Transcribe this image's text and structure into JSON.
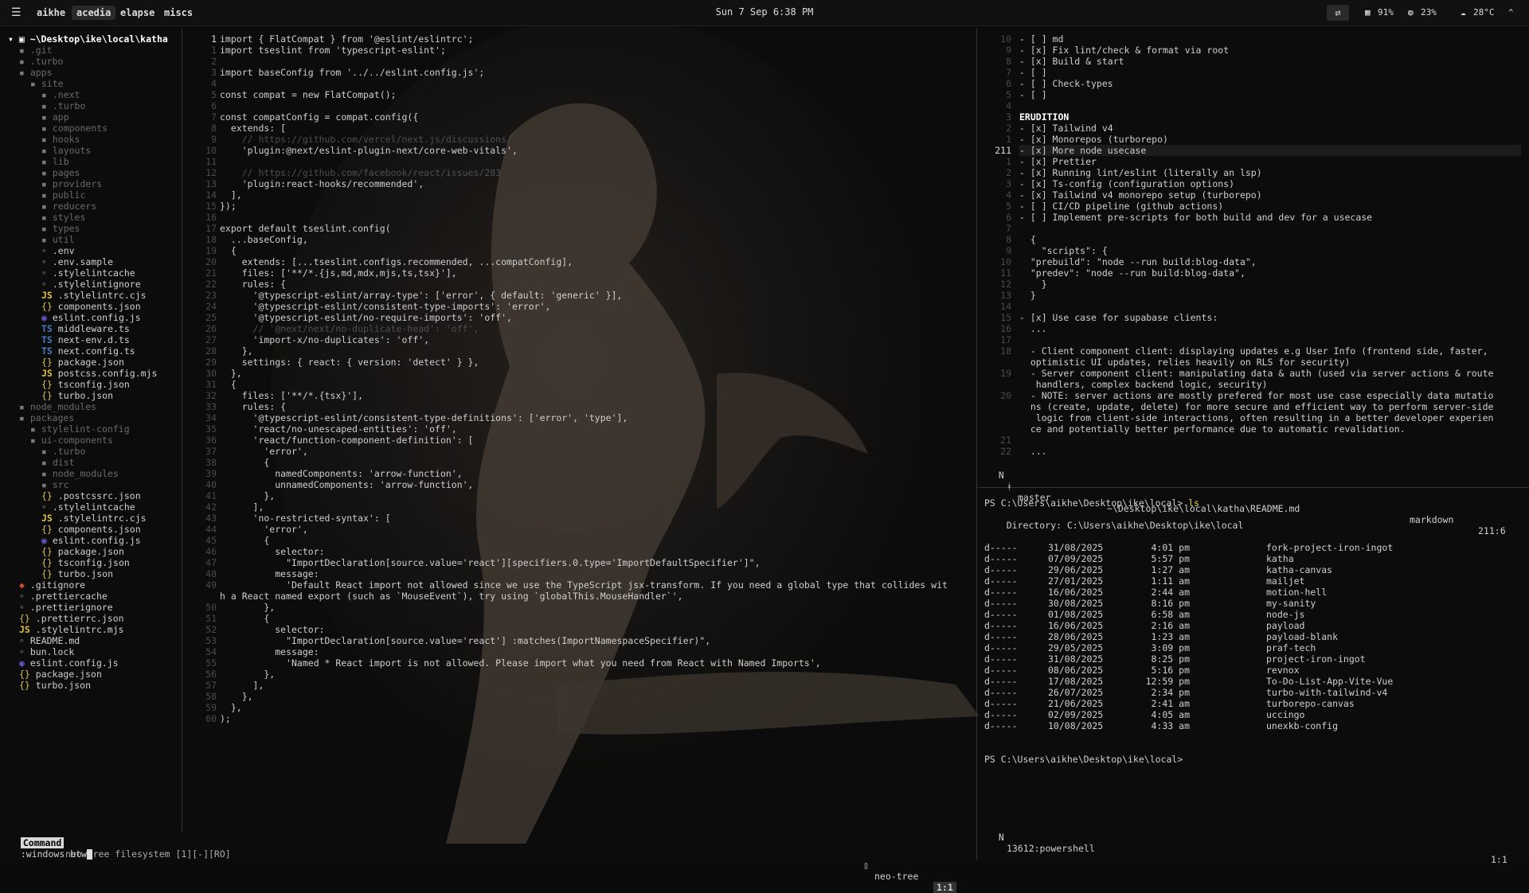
{
  "topbar": {
    "workspaces": [
      "aikhe",
      "acedia",
      "elapse",
      "miscs"
    ],
    "active_workspace": "acedia",
    "clock": "Sun 7 Sep 6:38 PM",
    "cpu": "91%",
    "mem": "23%",
    "temp": "28°C"
  },
  "tree": {
    "root": "~\\Desktop\\ike\\local\\katha",
    "items": [
      ".git",
      ".turbo",
      "apps",
      "site",
      ".next",
      ".turbo",
      "app",
      "components",
      "hooks",
      "layouts",
      "lib",
      "pages",
      "providers",
      "public",
      "reducers",
      "styles",
      "types",
      "util",
      ".env",
      ".env.sample",
      ".stylelintcache",
      ".stylelintignore",
      ".stylelintrc.cjs",
      "components.json",
      "eslint.config.js",
      "middleware.ts",
      "next-env.d.ts",
      "next.config.ts",
      "package.json",
      "postcss.config.mjs",
      "tsconfig.json",
      "turbo.json",
      "node_modules",
      "packages",
      "stylelint-config",
      "ui-components",
      ".turbo",
      "dist",
      "node_modules",
      "src",
      ".postcssrc.json",
      ".stylelintcache",
      ".stylelintrc.cjs",
      "components.json",
      "eslint.config.js",
      "package.json",
      "tsconfig.json",
      "turbo.json",
      ".gitignore",
      ".prettiercache",
      ".prettierignore",
      ".prettierrc.json",
      ".stylelintrc.mjs",
      "README.md",
      "bun.lock",
      "eslint.config.js",
      "package.json",
      "turbo.json"
    ]
  },
  "code": {
    "lines": [
      "import { FlatCompat } from '@eslint/eslintrc';",
      "import tseslint from 'typescript-eslint';",
      "",
      "import baseConfig from '../../eslint.config.js';",
      "",
      "const compat = new FlatCompat();",
      "",
      "const compatConfig = compat.config({",
      "  extends: [",
      "    // https://github.com/vercel/next.js/discussions/",
      "    'plugin:@next/eslint-plugin-next/core-web-vitals',",
      "",
      "    // https://github.com/facebook/react/issues/283",
      "    'plugin:react-hooks/recommended',",
      "  ],",
      "});",
      "",
      "export default tseslint.config(",
      "  ...baseConfig,",
      "  {",
      "    extends: [...tseslint.configs.recommended, ...compatConfig],",
      "    files: ['**/*.{js,md,mdx,mjs,ts,tsx}'],",
      "    rules: {",
      "      '@typescript-eslint/array-type': ['error', { default: 'generic' }],",
      "      '@typescript-eslint/consistent-type-imports': 'error',",
      "      '@typescript-eslint/no-require-imports': 'off',",
      "      // '@next/next/no-duplicate-head': 'off',",
      "      'import-x/no-duplicates': 'off',",
      "    },",
      "    settings: { react: { version: 'detect' } },",
      "  },",
      "  {",
      "    files: ['**/*.{tsx}'],",
      "    rules: {",
      "      '@typescript-eslint/consistent-type-definitions': ['error', 'type'],",
      "      'react/no-unescaped-entities': 'off',",
      "      'react/function-component-definition': [",
      "        'error',",
      "        {",
      "          namedComponents: 'arrow-function',",
      "          unnamedComponents: 'arrow-function',",
      "        },",
      "      ],",
      "      'no-restricted-syntax': [",
      "        'error',",
      "        {",
      "          selector:",
      "            \"ImportDeclaration[source.value='react'][specifiers.0.type='ImportDefaultSpecifier']\",",
      "          message:",
      "            'Default React import not allowed since we use the TypeScript jsx-transform. If you need a global type that collides wit",
      "h a React named export (such as `MouseEvent`), try using `globalThis.MouseHandler`',",
      "        },",
      "        {",
      "          selector:",
      "            \"ImportDeclaration[source.value='react'] :matches(ImportNamespaceSpecifier)\",",
      "          message:",
      "            'Named * React import is not allowed. Please import what you need from React with Named Imports',",
      "        },",
      "      ],",
      "    },",
      "  },",
      ");"
    ],
    "gutter": [
      "1",
      "1",
      "2",
      "3",
      "4",
      "5",
      "6",
      "7",
      "8",
      "9",
      "10",
      "11",
      "12",
      "13",
      "14",
      "15",
      "16",
      "17",
      "18",
      "19",
      "20",
      "21",
      "22",
      "23",
      "24",
      "25",
      "26",
      "27",
      "28",
      "29",
      "30",
      "31",
      "32",
      "33",
      "34",
      "35",
      "36",
      "37",
      "38",
      "39",
      "40",
      "41",
      "42",
      "43",
      "44",
      "45",
      "46",
      "47",
      "48",
      "49",
      "",
      "50",
      "51",
      "52",
      "53",
      "54",
      "55",
      "56",
      "57",
      "58",
      "59",
      "60"
    ]
  },
  "notes": {
    "gutter": [
      "10",
      "9",
      "8",
      "7",
      "6",
      "5",
      "4",
      "3",
      "2",
      "1",
      "211",
      "1",
      "2",
      "3",
      "4",
      "5",
      "6",
      "7",
      "8",
      "9",
      "10",
      "11",
      "12",
      "13",
      "14",
      "15",
      "16",
      "17",
      "18",
      "",
      "19",
      "",
      "20",
      "",
      "",
      "",
      "21",
      "22"
    ],
    "lines": [
      "- [ ] md",
      "- [x] Fix lint/check & format via root",
      "- [x] Build & start",
      "- [ ]",
      "- [ ] Check-types",
      "- [ ]",
      "",
      "ERUDITION",
      "- [x] Tailwind v4",
      "- [x] Monorepos (turborepo)",
      "- [x] More node usecase",
      "- [x] Prettier",
      "- [x] Running lint/eslint (literally an lsp)",
      "- [x] Ts-config (configuration options)",
      "- [x] Tailwind v4 monorepo setup (turborepo)",
      "- [ ] CI/CD pipeline (github actions)",
      "- [ ] Implement pre-scripts for both build and dev for a usecase",
      "",
      "  {",
      "    \"scripts\": {",
      "  \"prebuild\": \"node --run build:blog-data\",",
      "  \"predev\": \"node --run build:blog-data\",",
      "    }",
      "  }",
      "",
      "- [x] Use case for supabase clients:",
      "  ...",
      "",
      "  - Client component client: displaying updates e.g User Info (frontend side, faster,",
      "  optimistic UI updates, relies heavily on RLS for security)",
      "  - Server component client: manipulating data & auth (used via server actions & route",
      "   handlers, complex backend logic, security)",
      "  - NOTE: server actions are mostly prefered for most use case especially data mutatio",
      "  ns (create, update, delete) for more secure and efficient way to perform server-side",
      "   logic from client-side interactions, often resulting in a better developer experien",
      "  ce and potentially better performance due to automatic revalidation.",
      "",
      "  ..."
    ],
    "status": {
      "mode": "N",
      "branch": "master",
      "path": "~\\Desktop\\ike\\local\\katha\\README.md",
      "filetype": "markdown",
      "pos": "211:6"
    }
  },
  "terminal": {
    "prompt1": "PS C:\\Users\\aikhe\\Desktop\\ike\\local>",
    "cmd1": "ls",
    "directory": "    Directory: C:\\Users\\aikhe\\Desktop\\ike\\local",
    "rows": [
      [
        "d-----",
        "31/08/2025",
        "4:01 pm",
        "fork-project-iron-ingot"
      ],
      [
        "d-----",
        "07/09/2025",
        "5:57 pm",
        "katha"
      ],
      [
        "d-----",
        "29/06/2025",
        "1:27 am",
        "katha-canvas"
      ],
      [
        "d-----",
        "27/01/2025",
        "1:11 am",
        "mailjet"
      ],
      [
        "d-----",
        "16/06/2025",
        "2:44 am",
        "motion-hell"
      ],
      [
        "d-----",
        "30/08/2025",
        "8:16 pm",
        "my-sanity"
      ],
      [
        "d-----",
        "01/08/2025",
        "6:58 am",
        "node-js"
      ],
      [
        "d-----",
        "16/06/2025",
        "2:16 am",
        "payload"
      ],
      [
        "d-----",
        "28/06/2025",
        "1:23 am",
        "payload-blank"
      ],
      [
        "d-----",
        "29/05/2025",
        "3:09 pm",
        "praf-tech"
      ],
      [
        "d-----",
        "31/08/2025",
        "8:25 pm",
        "project-iron-ingot"
      ],
      [
        "d-----",
        "08/06/2025",
        "5:16 pm",
        "revnox"
      ],
      [
        "d-----",
        "17/08/2025",
        "12:59 pm",
        "To-Do-List-App-Vite-Vue"
      ],
      [
        "d-----",
        "26/07/2025",
        "2:34 pm",
        "turbo-with-tailwind-v4"
      ],
      [
        "d-----",
        "21/06/2025",
        "2:41 am",
        "turborepo-canvas"
      ],
      [
        "d-----",
        "02/09/2025",
        "4:05 am",
        "uccingo"
      ],
      [
        "d-----",
        "10/08/2025",
        "4:33 am",
        "unexkb-config"
      ]
    ],
    "prompt2": "PS C:\\Users\\aikhe\\Desktop\\ike\\local>",
    "status": {
      "mode": "N",
      "name": "13612:powershell",
      "pos": "1:1"
    }
  },
  "left_status": {
    "mode": "Command",
    "info": "neo-tree filesystem [1][-][RO]",
    "name": "neo-tree",
    "pos": "1:1"
  },
  "cmdline": ":windows btw"
}
